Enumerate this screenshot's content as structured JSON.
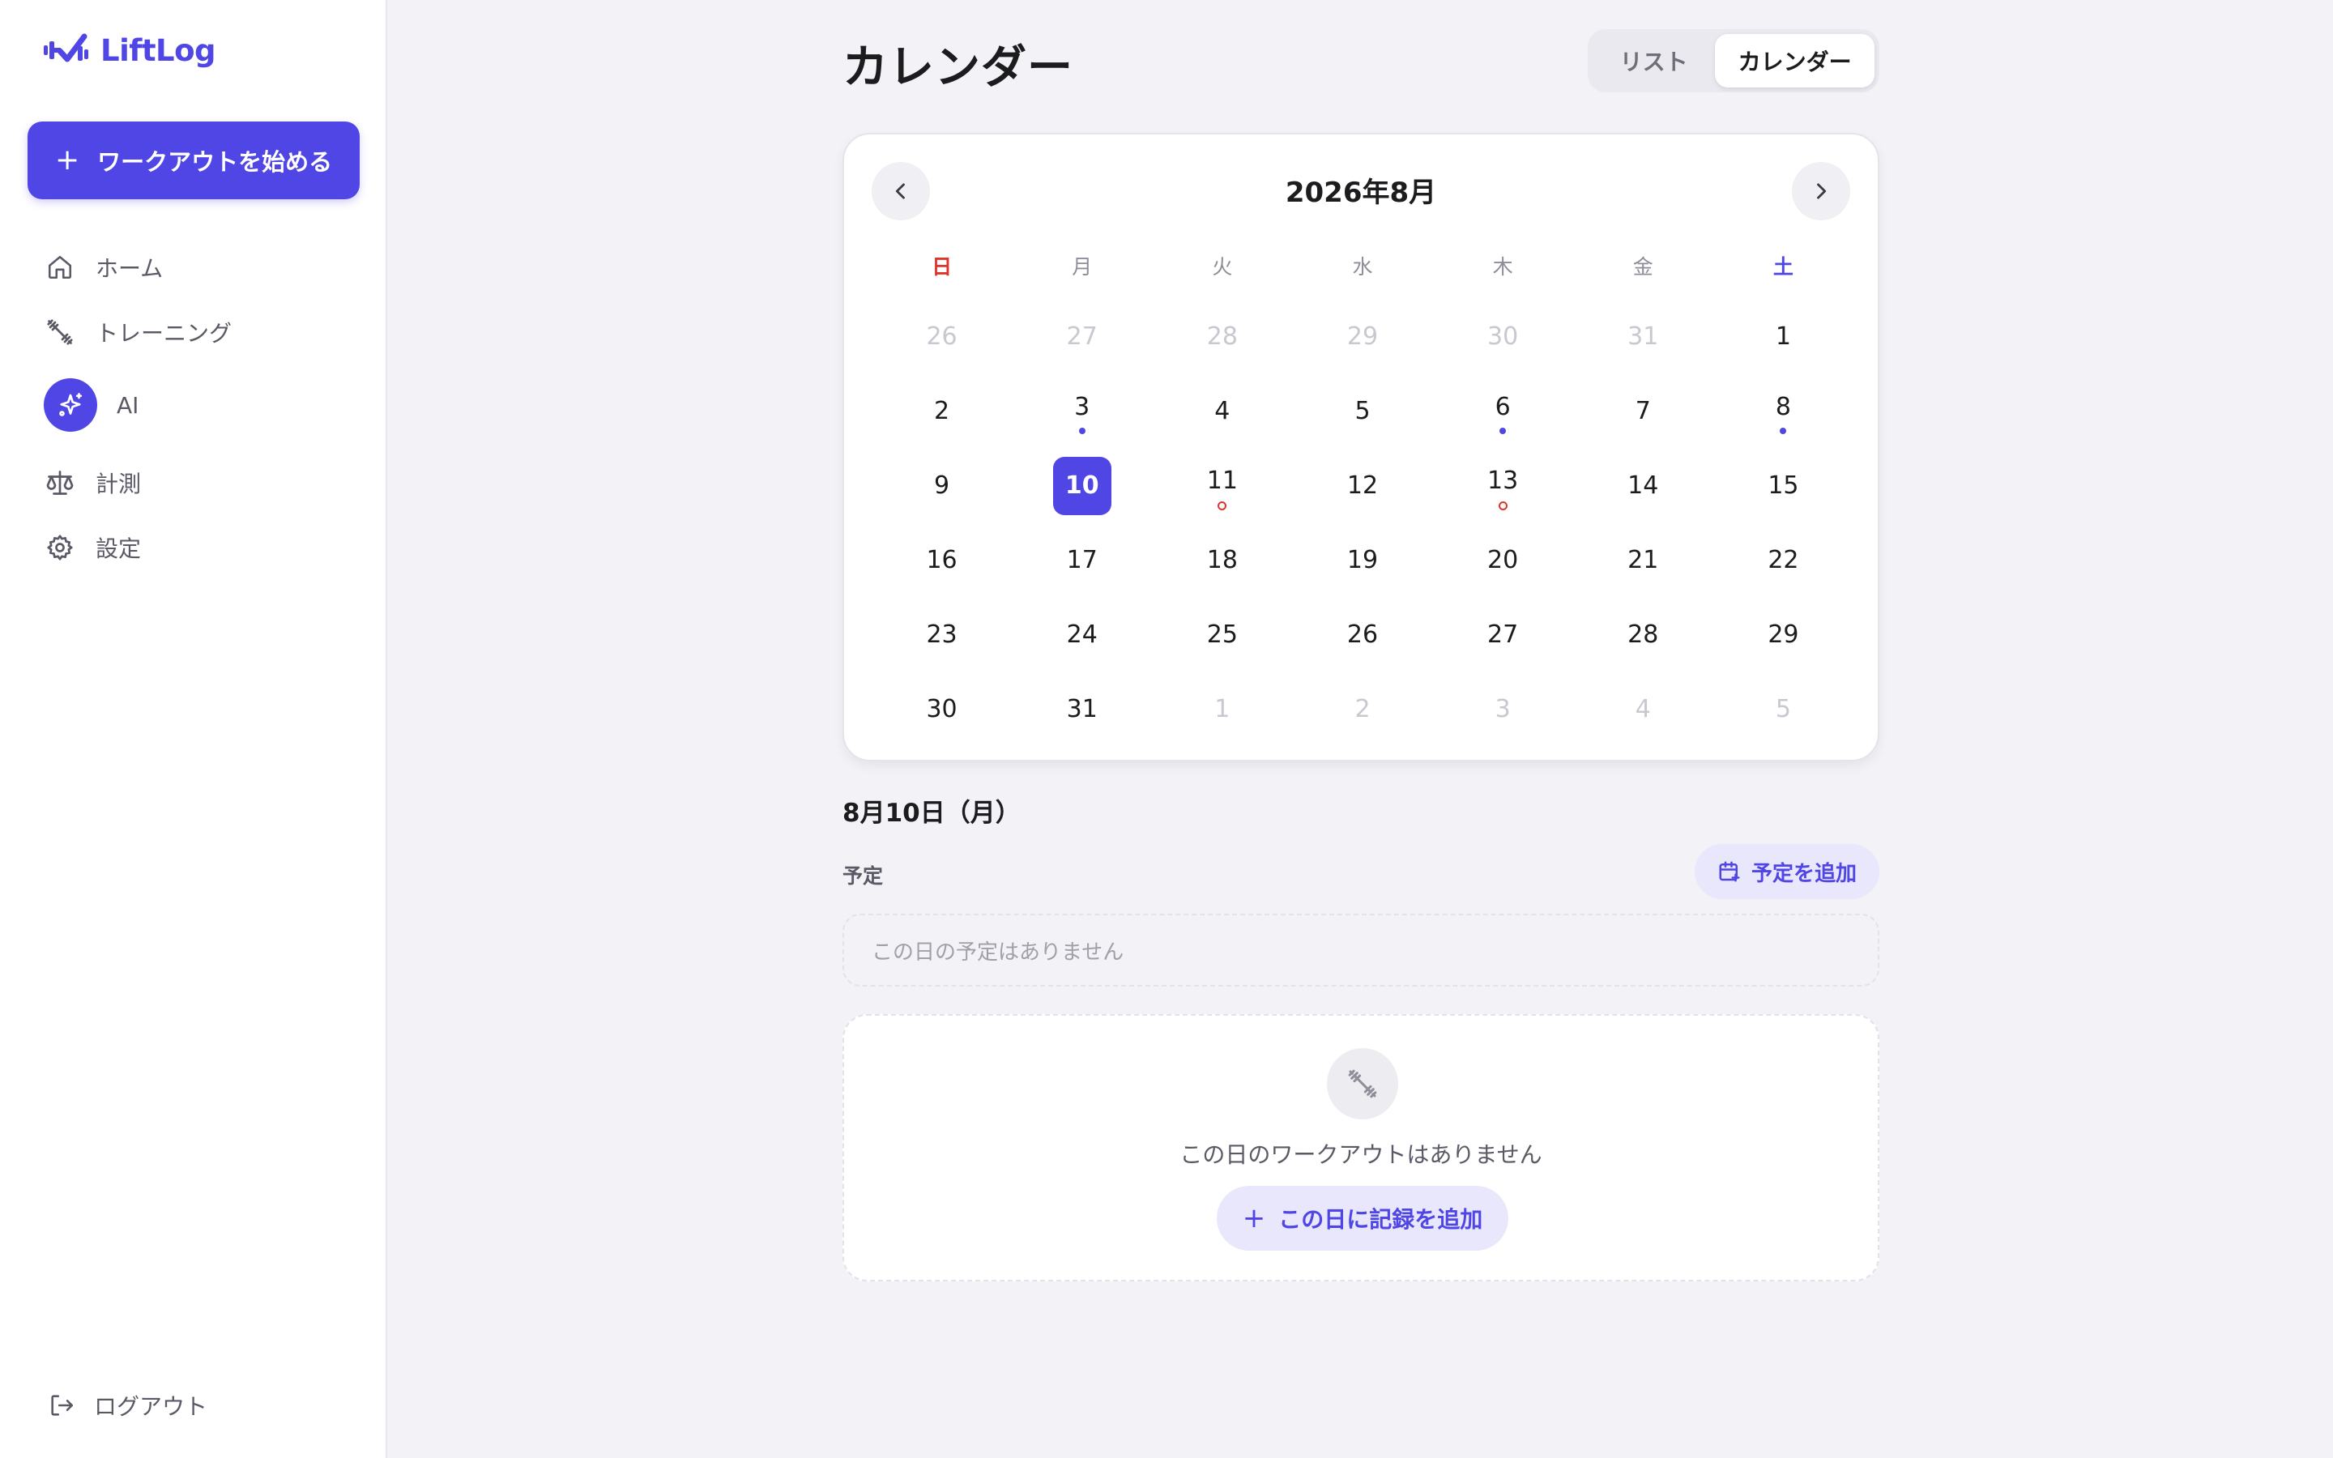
{
  "app": {
    "name": "LiftLog"
  },
  "sidebar": {
    "start_button": "ワークアウトを始める",
    "items": [
      {
        "label": "ホーム",
        "icon": "home-icon"
      },
      {
        "label": "トレーニング",
        "icon": "dumbbell-icon"
      },
      {
        "label": "AI",
        "icon": "sparkles-icon"
      },
      {
        "label": "計測",
        "icon": "scale-icon"
      },
      {
        "label": "設定",
        "icon": "gear-icon"
      }
    ],
    "logout": "ログアウト"
  },
  "header": {
    "title": "カレンダー",
    "toggle": {
      "list": "リスト",
      "calendar": "カレンダー",
      "active": "calendar"
    }
  },
  "calendar": {
    "month_label": "2026年8月",
    "weekdays": [
      "日",
      "月",
      "火",
      "水",
      "木",
      "金",
      "土"
    ],
    "days": [
      {
        "n": "26",
        "other": true
      },
      {
        "n": "27",
        "other": true
      },
      {
        "n": "28",
        "other": true
      },
      {
        "n": "29",
        "other": true
      },
      {
        "n": "30",
        "other": true
      },
      {
        "n": "31",
        "other": true
      },
      {
        "n": "1"
      },
      {
        "n": "2"
      },
      {
        "n": "3",
        "dot": "filled"
      },
      {
        "n": "4"
      },
      {
        "n": "5"
      },
      {
        "n": "6",
        "dot": "filled"
      },
      {
        "n": "7"
      },
      {
        "n": "8",
        "dot": "filled"
      },
      {
        "n": "9"
      },
      {
        "n": "10",
        "selected": true
      },
      {
        "n": "11",
        "dot": "ring"
      },
      {
        "n": "12"
      },
      {
        "n": "13",
        "dot": "ring"
      },
      {
        "n": "14"
      },
      {
        "n": "15"
      },
      {
        "n": "16"
      },
      {
        "n": "17"
      },
      {
        "n": "18"
      },
      {
        "n": "19"
      },
      {
        "n": "20"
      },
      {
        "n": "21"
      },
      {
        "n": "22"
      },
      {
        "n": "23"
      },
      {
        "n": "24"
      },
      {
        "n": "25"
      },
      {
        "n": "26"
      },
      {
        "n": "27"
      },
      {
        "n": "28"
      },
      {
        "n": "29"
      },
      {
        "n": "30"
      },
      {
        "n": "31"
      },
      {
        "n": "1",
        "other": true
      },
      {
        "n": "2",
        "other": true
      },
      {
        "n": "3",
        "other": true
      },
      {
        "n": "4",
        "other": true
      },
      {
        "n": "5",
        "other": true
      }
    ]
  },
  "detail": {
    "date_heading": "8月10日（月）",
    "plan_label": "予定",
    "add_plan": "予定を追加",
    "empty_plan": "この日の予定はありません",
    "empty_workout": "この日のワークアウトはありません",
    "add_record": "この日に記録を追加"
  },
  "colors": {
    "accent": "#4f46e5",
    "sunday": "#e0342b",
    "background": "#f2f2f7"
  }
}
